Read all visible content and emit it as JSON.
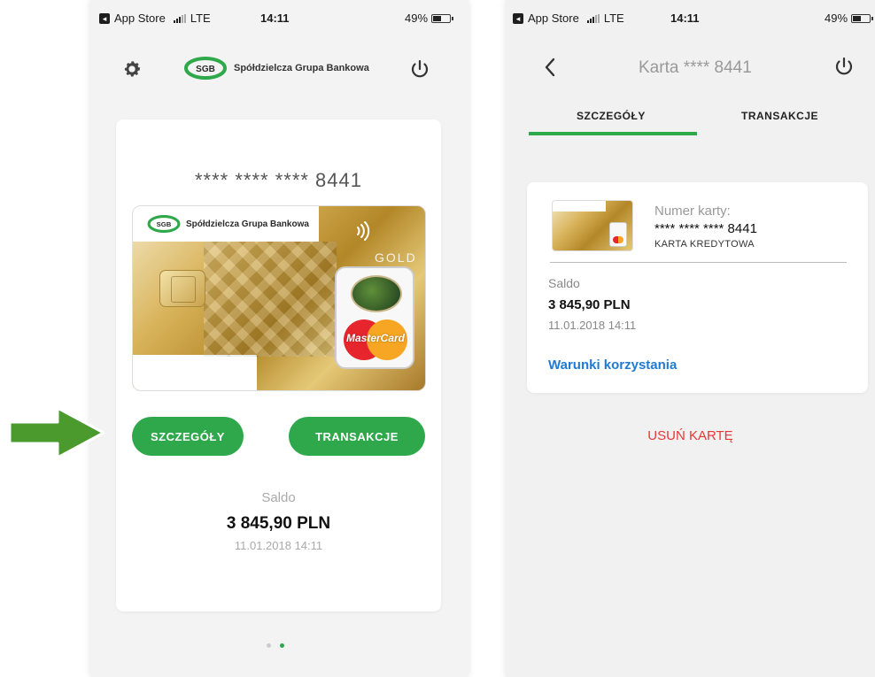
{
  "left_screen": {
    "status": {
      "carrier": "App Store",
      "network": "LTE",
      "time": "14:11",
      "battery": "49%"
    },
    "header": {
      "brand_name": "Spółdzielcza Grupa Bankowa",
      "logo_text": "SGB"
    },
    "card": {
      "masked_number": "**** **** **** 8441",
      "image_brand_text": "Spółdzielcza Grupa Bankowa",
      "image_logo_text": "SGB",
      "image_tier": "GOLD",
      "image_network": "MasterCard"
    },
    "buttons": {
      "details": "SZCZEGÓŁY",
      "transactions": "TRANSAKCJE"
    },
    "balance": {
      "label": "Saldo",
      "amount": "3 845,90 PLN",
      "date": "11.01.2018 14:11"
    },
    "pager": {
      "count": 2,
      "active_index": 1
    }
  },
  "right_screen": {
    "status": {
      "carrier": "App Store",
      "network": "LTE",
      "time": "14:11",
      "battery": "49%"
    },
    "title": "Karta **** 8441",
    "tabs": [
      {
        "label": "SZCZEGÓŁY",
        "active": true
      },
      {
        "label": "TRANSAKCJE",
        "active": false
      }
    ],
    "detail": {
      "number_label": "Numer karty:",
      "number_value": "**** **** **** 8441",
      "card_type": "KARTA KREDYTOWA",
      "balance_label": "Saldo",
      "balance_amount": "3 845,90 PLN",
      "balance_date": "11.01.2018 14:11",
      "terms_link": "Warunki korzystania"
    },
    "remove_card": "USUŃ KARTĘ"
  },
  "colors": {
    "accent_green": "#2ea84b",
    "link_blue": "#1f7ad6",
    "danger_red": "#e53935",
    "arrow_green": "#4a9a2e"
  },
  "icons": [
    "gear-icon",
    "power-icon",
    "chevron-left-icon",
    "contactless-icon",
    "arrow-right-icon"
  ]
}
